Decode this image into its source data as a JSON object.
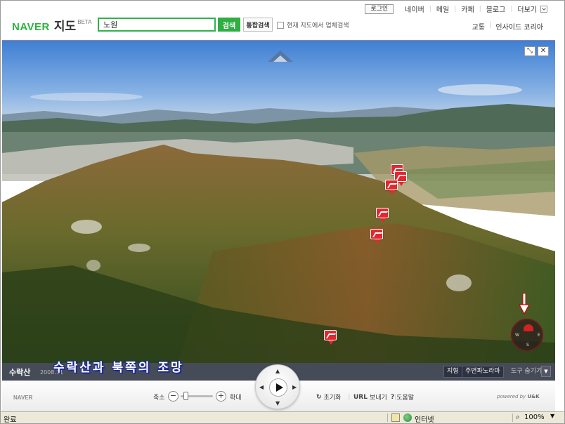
{
  "header": {
    "logo_naver": "NAVER",
    "logo_jido": "지도",
    "logo_beta": "BETA",
    "search_value": "노원",
    "search_button": "검색",
    "unified_search_button": "통합검색",
    "local_search_label": "현재 지도에서 업체검색"
  },
  "topnav": {
    "login": "로그인",
    "items": [
      "네이버",
      "메일",
      "카페",
      "블로그",
      "더보기"
    ]
  },
  "subnav": {
    "items": [
      "교통",
      "인사이드 코리아"
    ]
  },
  "panorama": {
    "resize_icon": "⤡",
    "close_icon": "✕",
    "place_name": "수락산",
    "photo_date": "2008.11",
    "caption": "수락산과 북쪽의 조망",
    "terrain_button": "지형",
    "nearby_button": "주변파노라마",
    "tools_button": "도구 숨기기",
    "compass_labels": [
      "W",
      "E",
      "S"
    ]
  },
  "controlbar": {
    "naver_small": "NAVER",
    "zoom_out": "축소",
    "zoom_in": "확대",
    "reset": "초기화",
    "url_view": "보내기",
    "url_prefix": "URL",
    "help": "도움말",
    "powered_by": "powered by",
    "powered_brand": "U&K"
  },
  "statusbar": {
    "status": "완료",
    "zone": "인터넷",
    "zoom": "100%"
  }
}
